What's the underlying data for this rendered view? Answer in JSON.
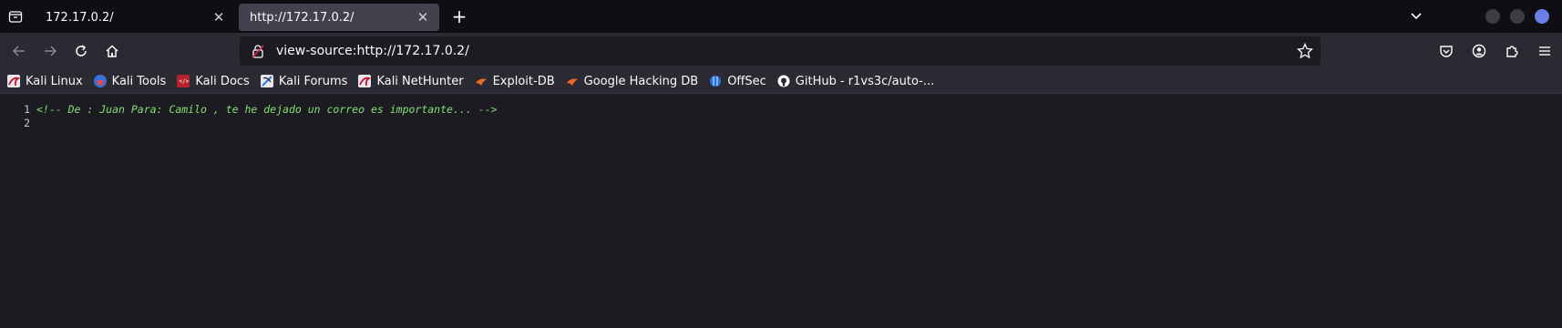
{
  "tabs": [
    {
      "title": "172.17.0.2/",
      "active": false
    },
    {
      "title": "http://172.17.0.2/",
      "active": true
    }
  ],
  "urlbar": {
    "url": "view-source:http://172.17.0.2/"
  },
  "bookmarks": [
    {
      "label": "Kali Linux",
      "icon": "kali-dragon-icon"
    },
    {
      "label": "Kali Tools",
      "icon": "kali-tools-icon"
    },
    {
      "label": "Kali Docs",
      "icon": "kali-docs-icon"
    },
    {
      "label": "Kali Forums",
      "icon": "kali-forums-icon"
    },
    {
      "label": "Kali NetHunter",
      "icon": "kali-nethunter-icon"
    },
    {
      "label": "Exploit-DB",
      "icon": "exploit-db-icon"
    },
    {
      "label": "Google Hacking DB",
      "icon": "ghdb-icon"
    },
    {
      "label": "OffSec",
      "icon": "offsec-icon"
    },
    {
      "label": "GitHub - r1vs3c/auto-...",
      "icon": "github-icon"
    }
  ],
  "source_lines": [
    {
      "number": "1",
      "text": "<!-- De : Juan Para: Camilo , te he dejado un correo es importante... -->"
    },
    {
      "number": "2",
      "text": ""
    }
  ],
  "colors": {
    "background": "#1c1b22",
    "toolbar": "#2b2a33",
    "tabstrip": "#0f0e13",
    "comment": "#86de74",
    "accent": "#6b7fe8"
  }
}
